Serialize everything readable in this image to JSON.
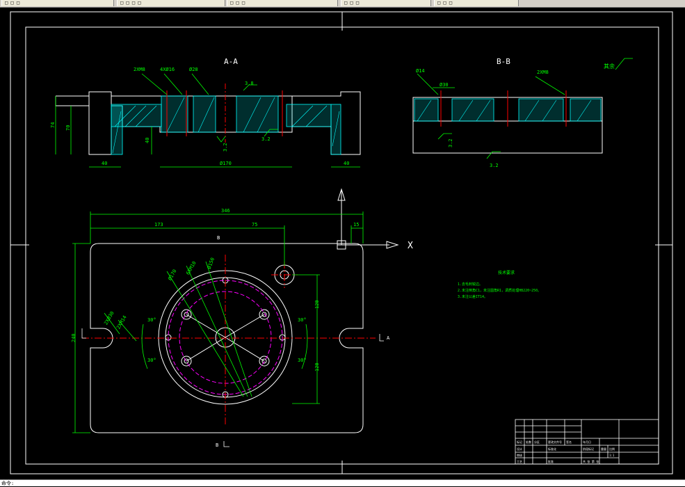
{
  "tabs": [
    {
      "label": "□ □ □ □"
    },
    {
      "label": "□ □ □"
    },
    {
      "label": "□ □ □"
    },
    {
      "label": "□ □ □"
    },
    {
      "label": "□ □ □"
    }
  ],
  "colors": {
    "background": "#000000",
    "outline": "#ffffff",
    "dimension": "#00ff00",
    "hatch": "#00ffff",
    "centerline": "#ff0000",
    "construction": "#ff00ff",
    "note": "#00ff00"
  },
  "sections": {
    "aa_title": "A-A",
    "bb_title": "B-B",
    "roughness_note": "其余",
    "aa": {
      "d_ul": "2XM8",
      "d_4x": "4XØ16",
      "d_phi28": "Ø28",
      "r38": "3.8",
      "r32a": "3.2",
      "r32b": "3.2",
      "h74": "74",
      "h70": "70",
      "d40l": "40",
      "h40": "40",
      "d170": "Ø170",
      "d40r": "40"
    },
    "bb": {
      "d14": "Ø14",
      "d30": "Ø30",
      "d2xm8": "2XM8",
      "r32a": "3.2",
      "r32b": "3.2"
    }
  },
  "plan": {
    "d346": "346",
    "d173": "173",
    "d75": "75",
    "d15": "15",
    "h240": "240",
    "d120a": "120",
    "d120b": "120",
    "phi10": "Ø170",
    "phi6m": "6XM10",
    "phi8": "Ø150",
    "a30_1": "30°",
    "a30_2": "30°",
    "a30_3": "30°",
    "a30_4": "30°",
    "l2x30": "2XØ30",
    "l2x4": "2XM14",
    "sec_b_top": "B",
    "sec_b_bottom": "B",
    "sec_a": "A",
    "axis_x": "X"
  },
  "notes": {
    "title": "技术要求",
    "items": [
      "1.去毛刺锐边。",
      "2.未注倒角C1，未注圆角R1，调质处理HB220~250。",
      "3.未注公差IT14。"
    ]
  },
  "title_block": {
    "cells": [
      "标记",
      "处数",
      "分区",
      "更改文件号",
      "签名",
      "年月日",
      "设计",
      "标准化",
      "阶段标记",
      "重量",
      "比例",
      "审核",
      "工艺",
      "批准",
      "共 张 第 张",
      "1:1"
    ]
  },
  "command_prompt": "命令:"
}
